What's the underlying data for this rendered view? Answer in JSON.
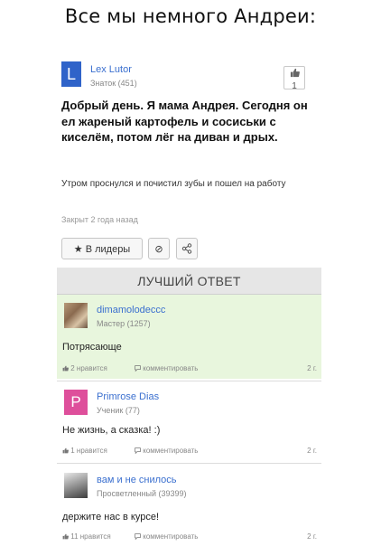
{
  "caption": "Все мы немного Андреи:",
  "question": {
    "avatar_letter": "L",
    "author": "Lex Lutor",
    "rank": "Знаток (451)",
    "like_icon": "thumbs-up",
    "like_count": "1",
    "title": "Добрый день. Я мама Андрея. Сегодня он ел жареный картофель и сосиськи с киселём, потом лёг на диван и дрых.",
    "body": "Утром проснулся и почистил зубы и пошел на работу",
    "closed": "Закрыт 2 года назад",
    "leaders_button": "★ В лидеры",
    "ban_icon": "⊘",
    "share_icon": "share"
  },
  "best_answer_header": "ЛУЧШИЙ ОТВЕТ",
  "answers": [
    {
      "name": "dimamolodeccc",
      "rank": "Мастер (1257)",
      "text": "Потрясающе",
      "likes": "2 нравится",
      "comment": "комментировать",
      "age": "2 г."
    },
    {
      "avatar_letter": "P",
      "name": "Primrose Dias",
      "rank": "Ученик (77)",
      "text": "Не жизнь, а сказка! :)",
      "likes": "1 нравится",
      "comment": "комментировать",
      "age": "2 г."
    },
    {
      "name": "вам и не снилось",
      "rank": "Просветленный (39399)",
      "text": "держите нас в курсе!",
      "likes": "11 нравится",
      "comment": "комментировать",
      "age": "2 г."
    }
  ],
  "colors": {
    "link_blue": "#3a6fcf",
    "avatar_blue": "#2f63c9",
    "avatar_pink": "#de4f9b",
    "best_answer_bg": "#e8f6dd"
  }
}
